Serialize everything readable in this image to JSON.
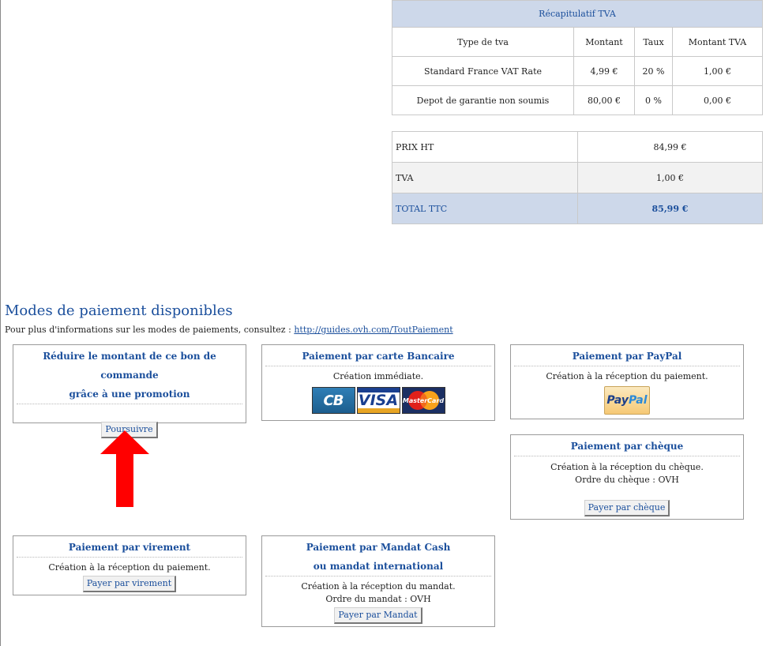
{
  "vat_summary": {
    "title": "Récapitulatif TVA",
    "columns": [
      "Type de tva",
      "Montant",
      "Taux",
      "Montant TVA"
    ],
    "rows": [
      [
        "Standard France VAT Rate",
        "4,99 €",
        "20 %",
        "1,00 €"
      ],
      [
        "Depot de garantie non soumis",
        "80,00 €",
        "0 %",
        "0,00 €"
      ]
    ]
  },
  "totals": {
    "prix_ht": {
      "label": "PRIX HT",
      "value": "84,99 €"
    },
    "tva": {
      "label": "TVA",
      "value": "1,00 €"
    },
    "total_ttc": {
      "label": "TOTAL TTC",
      "value": "85,99 €"
    }
  },
  "payment": {
    "heading": "Modes de paiement disponibles",
    "info_text": "Pour plus d'informations sur les modes de paiements, consultez :",
    "info_link": "http://guides.ovh.com/ToutPaiement",
    "promo": {
      "title_line1": "Réduire le montant de ce bon de commande",
      "title_line2": "grâce à une promotion",
      "button": "Poursuivre"
    },
    "card": {
      "title": "Paiement par carte Bancaire",
      "text": "Création immédiate.",
      "logos": [
        "CB",
        "VISA",
        "MasterCard"
      ]
    },
    "paypal": {
      "title": "Paiement par PayPal",
      "text": "Création à la réception du paiement.",
      "logo_part1": "Pay",
      "logo_part2": "Pal"
    },
    "cheque": {
      "title": "Paiement par chèque",
      "text1": "Création à la réception du chèque.",
      "text2": "Ordre du chèque : OVH",
      "button": "Payer par chèque"
    },
    "virement": {
      "title": "Paiement par virement",
      "text": "Création à la réception du paiement.",
      "button": "Payer par virement"
    },
    "mandat": {
      "title_line1": "Paiement par Mandat Cash",
      "title_line2": "ou mandat international",
      "text1": "Création à la réception du mandat.",
      "text2": "Ordre du mandat : OVH",
      "button": "Payer par Mandat"
    }
  },
  "colors": {
    "accent": "#1b4f9c",
    "header_bg": "#cdd8ea",
    "arrow": "#ff0000"
  }
}
